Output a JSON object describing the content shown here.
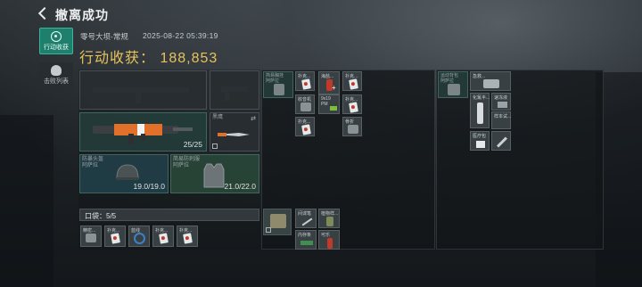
{
  "header": {
    "title": "撤离成功"
  },
  "tabs": [
    {
      "label": "行动收获",
      "icon": "target-icon",
      "active": true
    },
    {
      "label": "击败列表",
      "icon": "skull-icon",
      "active": false
    }
  ],
  "raid": {
    "map_mode": "零号大坝-常规",
    "timestamp": "2025-08-22 05:39:19",
    "earnings_label": "行动收获：",
    "earnings_value": "188,853"
  },
  "loadout": {
    "ammo_count": "25/25",
    "melee_label": "黑鹰",
    "helmet": {
      "label": "防暴头盔\n阿萨拉",
      "durability": "19.0/19.0"
    },
    "armor": {
      "label": "简易防刺服\n阿萨拉",
      "durability": "21.0/22.0"
    },
    "pocket": {
      "label": "口袋：",
      "count": "5/5"
    }
  },
  "pocket_items": [
    {
      "label": "精密..."
    },
    {
      "label": "扑克..."
    },
    {
      "label": "蓝线"
    },
    {
      "label": "扑克..."
    },
    {
      "label": "扑克..."
    }
  ],
  "chest_rig_label": "简易胸挂\n阿萨拉",
  "rig_items": [
    {
      "label": "扑克..."
    },
    {
      "label": "海盐..."
    },
    {
      "label": "扑克..."
    },
    {
      "label": "收音机"
    },
    {
      "label": "9x19\nPM"
    },
    {
      "label": "扑克..."
    },
    {
      "label": "扑克..."
    },
    {
      "label": "骨折"
    }
  ],
  "backpack_items": [
    {
      "label": "间谍笔"
    },
    {
      "label": "植物样..."
    },
    {
      "label": "内存条"
    },
    {
      "label": "可乐"
    }
  ],
  "case_label": "运动背包\n阿萨拉",
  "case_items": [
    {
      "label": "急救..."
    },
    {
      "label": "化氟半..."
    },
    {
      "label": "速冻液"
    },
    {
      "label": "样本试..."
    },
    {
      "label": "医疗包"
    }
  ],
  "colors": {
    "accent": "#1f7f6d",
    "gold": "#e7c35b"
  }
}
